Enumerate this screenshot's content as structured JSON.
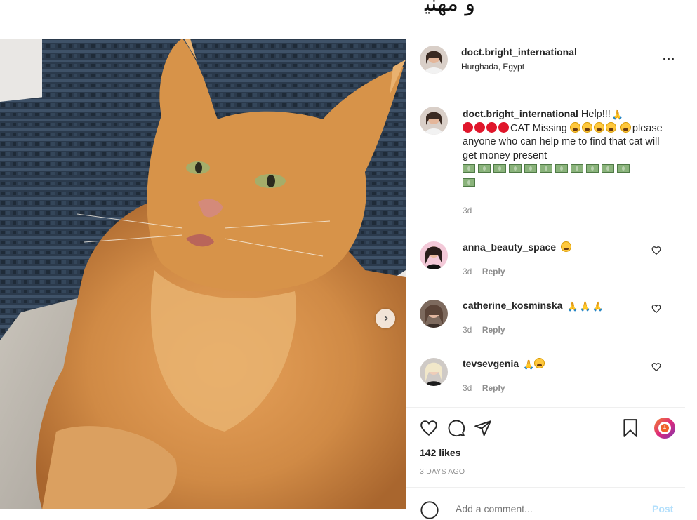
{
  "top_text": "ﻭ ﻣﻬﻨﻴ",
  "post": {
    "username": "doct.bright_international",
    "location": "Hurghada, Egypt",
    "more_label": "...",
    "caption": {
      "username": "doct.bright_international",
      "line1_text": "Help!!!",
      "cat_missing": "CAT Missing",
      "body": "please anyone who can help me to find that cat will get money present",
      "time": "3d"
    },
    "comments": [
      {
        "username": "anna_beauty_space",
        "time": "3d",
        "reply": "Reply"
      },
      {
        "username": "catherine_kosminska",
        "time": "3d",
        "reply": "Reply"
      },
      {
        "username": "tevsevgenia",
        "time": "3d",
        "reply": "Reply"
      }
    ],
    "likes": "142 likes",
    "posted_ago": "3 DAYS AGO",
    "add_comment_placeholder": "Add a comment...",
    "post_label": "Post"
  },
  "colors": {
    "accent_blue": "#0095f6",
    "post_disabled": "#b2dffc",
    "emoji_red": "#e0162b"
  },
  "icons": [
    "more-icon",
    "next-arrow-icon",
    "heart-icon",
    "comment-icon",
    "share-icon",
    "bookmark-icon",
    "download-badge-icon",
    "emoji-icon"
  ]
}
